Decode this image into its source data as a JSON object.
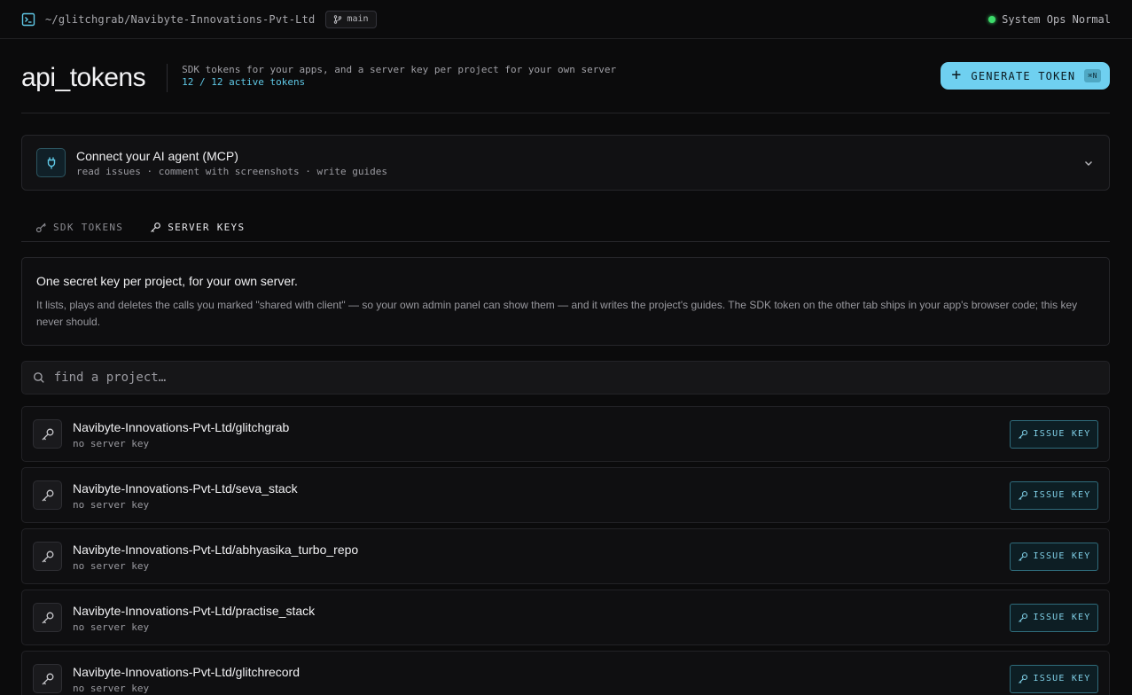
{
  "topbar": {
    "path": "~/glitchgrab/Navibyte-Innovations-Pvt-Ltd",
    "branch": "main",
    "status": "System Ops Normal"
  },
  "header": {
    "title": "api_tokens",
    "description": "SDK tokens for your apps, and a server key per project for your own server",
    "count": "12 / 12 active tokens",
    "generate_label": "GENERATE TOKEN",
    "shortcut": "⌘N"
  },
  "mcp": {
    "title": "Connect your AI agent (MCP)",
    "subtitle": "read issues · comment with screenshots · write guides"
  },
  "tabs": [
    {
      "label": "SDK TOKENS",
      "icon": "key-icon",
      "active": false
    },
    {
      "label": "SERVER KEYS",
      "icon": "key-icon",
      "active": true
    }
  ],
  "info": {
    "title": "One secret key per project, for your own server.",
    "body": "It lists, plays and deletes the calls you marked \"shared with client\" — so your own admin panel can show them — and it writes the project's guides. The SDK token on the other tab ships in your app's browser code; this key never should."
  },
  "search": {
    "placeholder": "find a project…"
  },
  "issue_label": "ISSUE KEY",
  "projects": [
    {
      "name": "Navibyte-Innovations-Pvt-Ltd/glitchgrab",
      "status": "no server key"
    },
    {
      "name": "Navibyte-Innovations-Pvt-Ltd/seva_stack",
      "status": "no server key"
    },
    {
      "name": "Navibyte-Innovations-Pvt-Ltd/abhyasika_turbo_repo",
      "status": "no server key"
    },
    {
      "name": "Navibyte-Innovations-Pvt-Ltd/practise_stack",
      "status": "no server key"
    },
    {
      "name": "Navibyte-Innovations-Pvt-Ltd/glitchrecord",
      "status": "no server key"
    }
  ],
  "colors": {
    "accent": "#6fd0f0",
    "status_ok": "#3ddc6b",
    "background": "#0b0b0c"
  }
}
